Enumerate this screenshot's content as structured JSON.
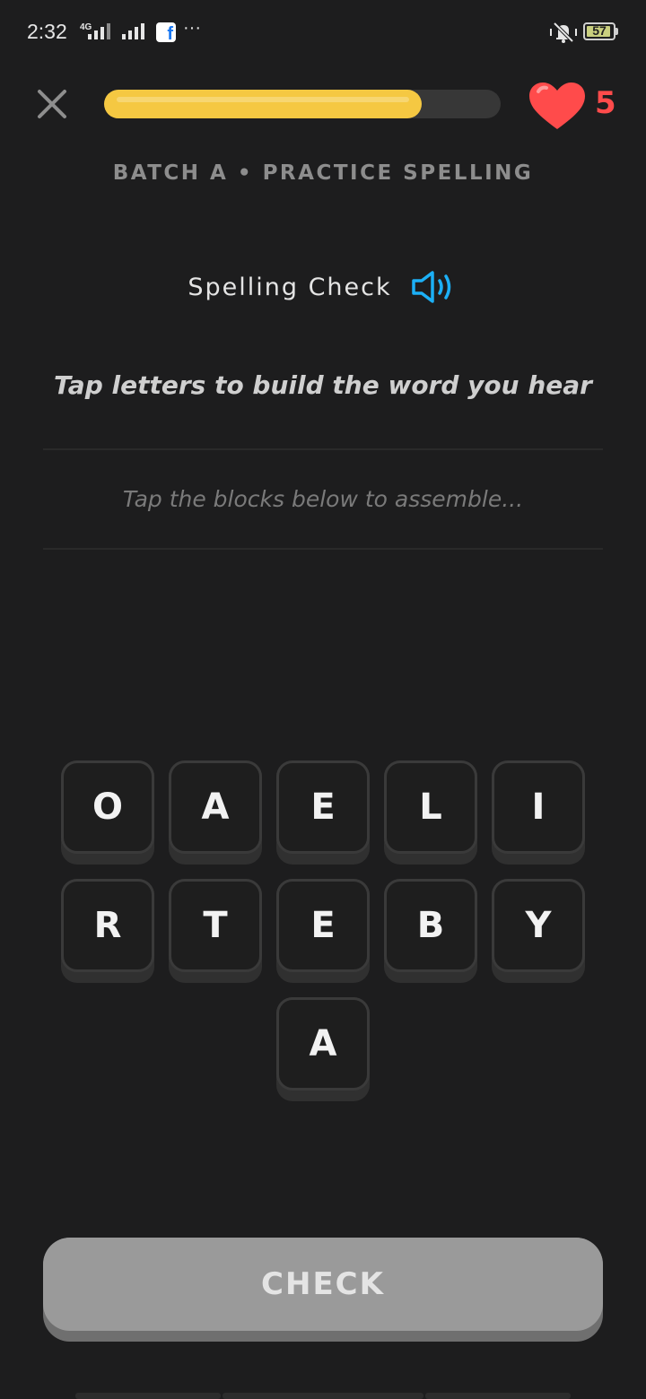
{
  "status_bar": {
    "time": "2:32",
    "network": "4G",
    "battery_level": "57"
  },
  "header": {
    "progress_fraction": 0.8,
    "lives": "5",
    "progress_color": "#f5c842",
    "heart_color": "#ff4b4b"
  },
  "lesson": {
    "subtitle": "BATCH A • PRACTICE SPELLING",
    "prompt_title": "Spelling Check",
    "instruction": "Tap letters to build the word you hear",
    "answer_placeholder": "Tap the blocks below to assemble..."
  },
  "tiles": {
    "row1": [
      "O",
      "A",
      "E",
      "L",
      "I"
    ],
    "row2": [
      "R",
      "T",
      "E",
      "B",
      "Y"
    ],
    "row3": [
      "A"
    ]
  },
  "check_button": {
    "label": "CHECK",
    "enabled": false
  },
  "accent_colors": {
    "speaker": "#1cb0f6"
  }
}
